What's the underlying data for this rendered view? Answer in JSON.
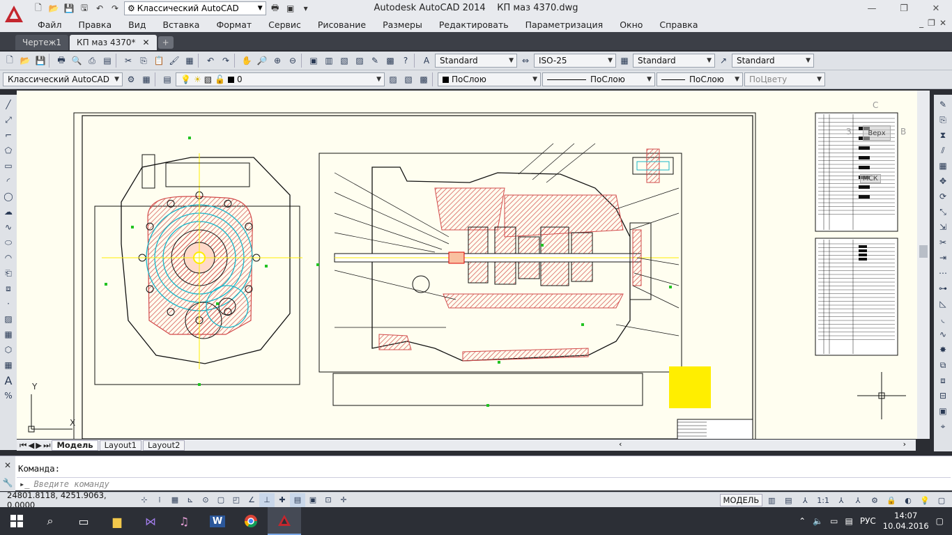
{
  "window": {
    "app_title": "Autodesk AutoCAD 2014",
    "file_title": "КП маз 4370.dwg",
    "workspace": "Классический AutoCAD"
  },
  "menu": [
    "Файл",
    "Правка",
    "Вид",
    "Вставка",
    "Формат",
    "Сервис",
    "Рисование",
    "Размеры",
    "Редактировать",
    "Параметризация",
    "Окно",
    "Справка"
  ],
  "doc_tabs": [
    {
      "label": "Чертеж1",
      "active": false
    },
    {
      "label": "КП маз 4370*",
      "active": true
    }
  ],
  "styles": {
    "text_style": "Standard",
    "dim_style": "ISO-25",
    "table_style": "Standard",
    "mleader_style": "Standard"
  },
  "layers": {
    "workspace": "Классический AutoCAD",
    "current_layer": "0",
    "color": "ПоСлою",
    "linetype": "ПоСлою",
    "lineweight": "ПоСлою",
    "plotstyle": "ПоЦвету"
  },
  "viewcube": {
    "top": "Верх",
    "n": "С",
    "e": "В",
    "w": "З",
    "ucs": "МСК"
  },
  "layout_tabs": [
    {
      "label": "Модель",
      "active": true
    },
    {
      "label": "Layout1",
      "active": false
    },
    {
      "label": "Layout2",
      "active": false
    }
  ],
  "ucs": {
    "x": "X",
    "y": "Y"
  },
  "command": {
    "history": "Команда:",
    "placeholder": "Введите команду"
  },
  "status": {
    "coords": "24801.8118, 4251.9063, 0.0000",
    "space": "МОДЕЛЬ",
    "scale": "1:1"
  },
  "taskbar": {
    "lang": "РУС",
    "time": "14:07",
    "date": "10.04.2016"
  },
  "colors": {
    "canvas": "#fffef0",
    "hatch": "#d24a4a",
    "cyan": "#19b5c9",
    "yellow": "#ffee00",
    "green": "#22c322"
  }
}
